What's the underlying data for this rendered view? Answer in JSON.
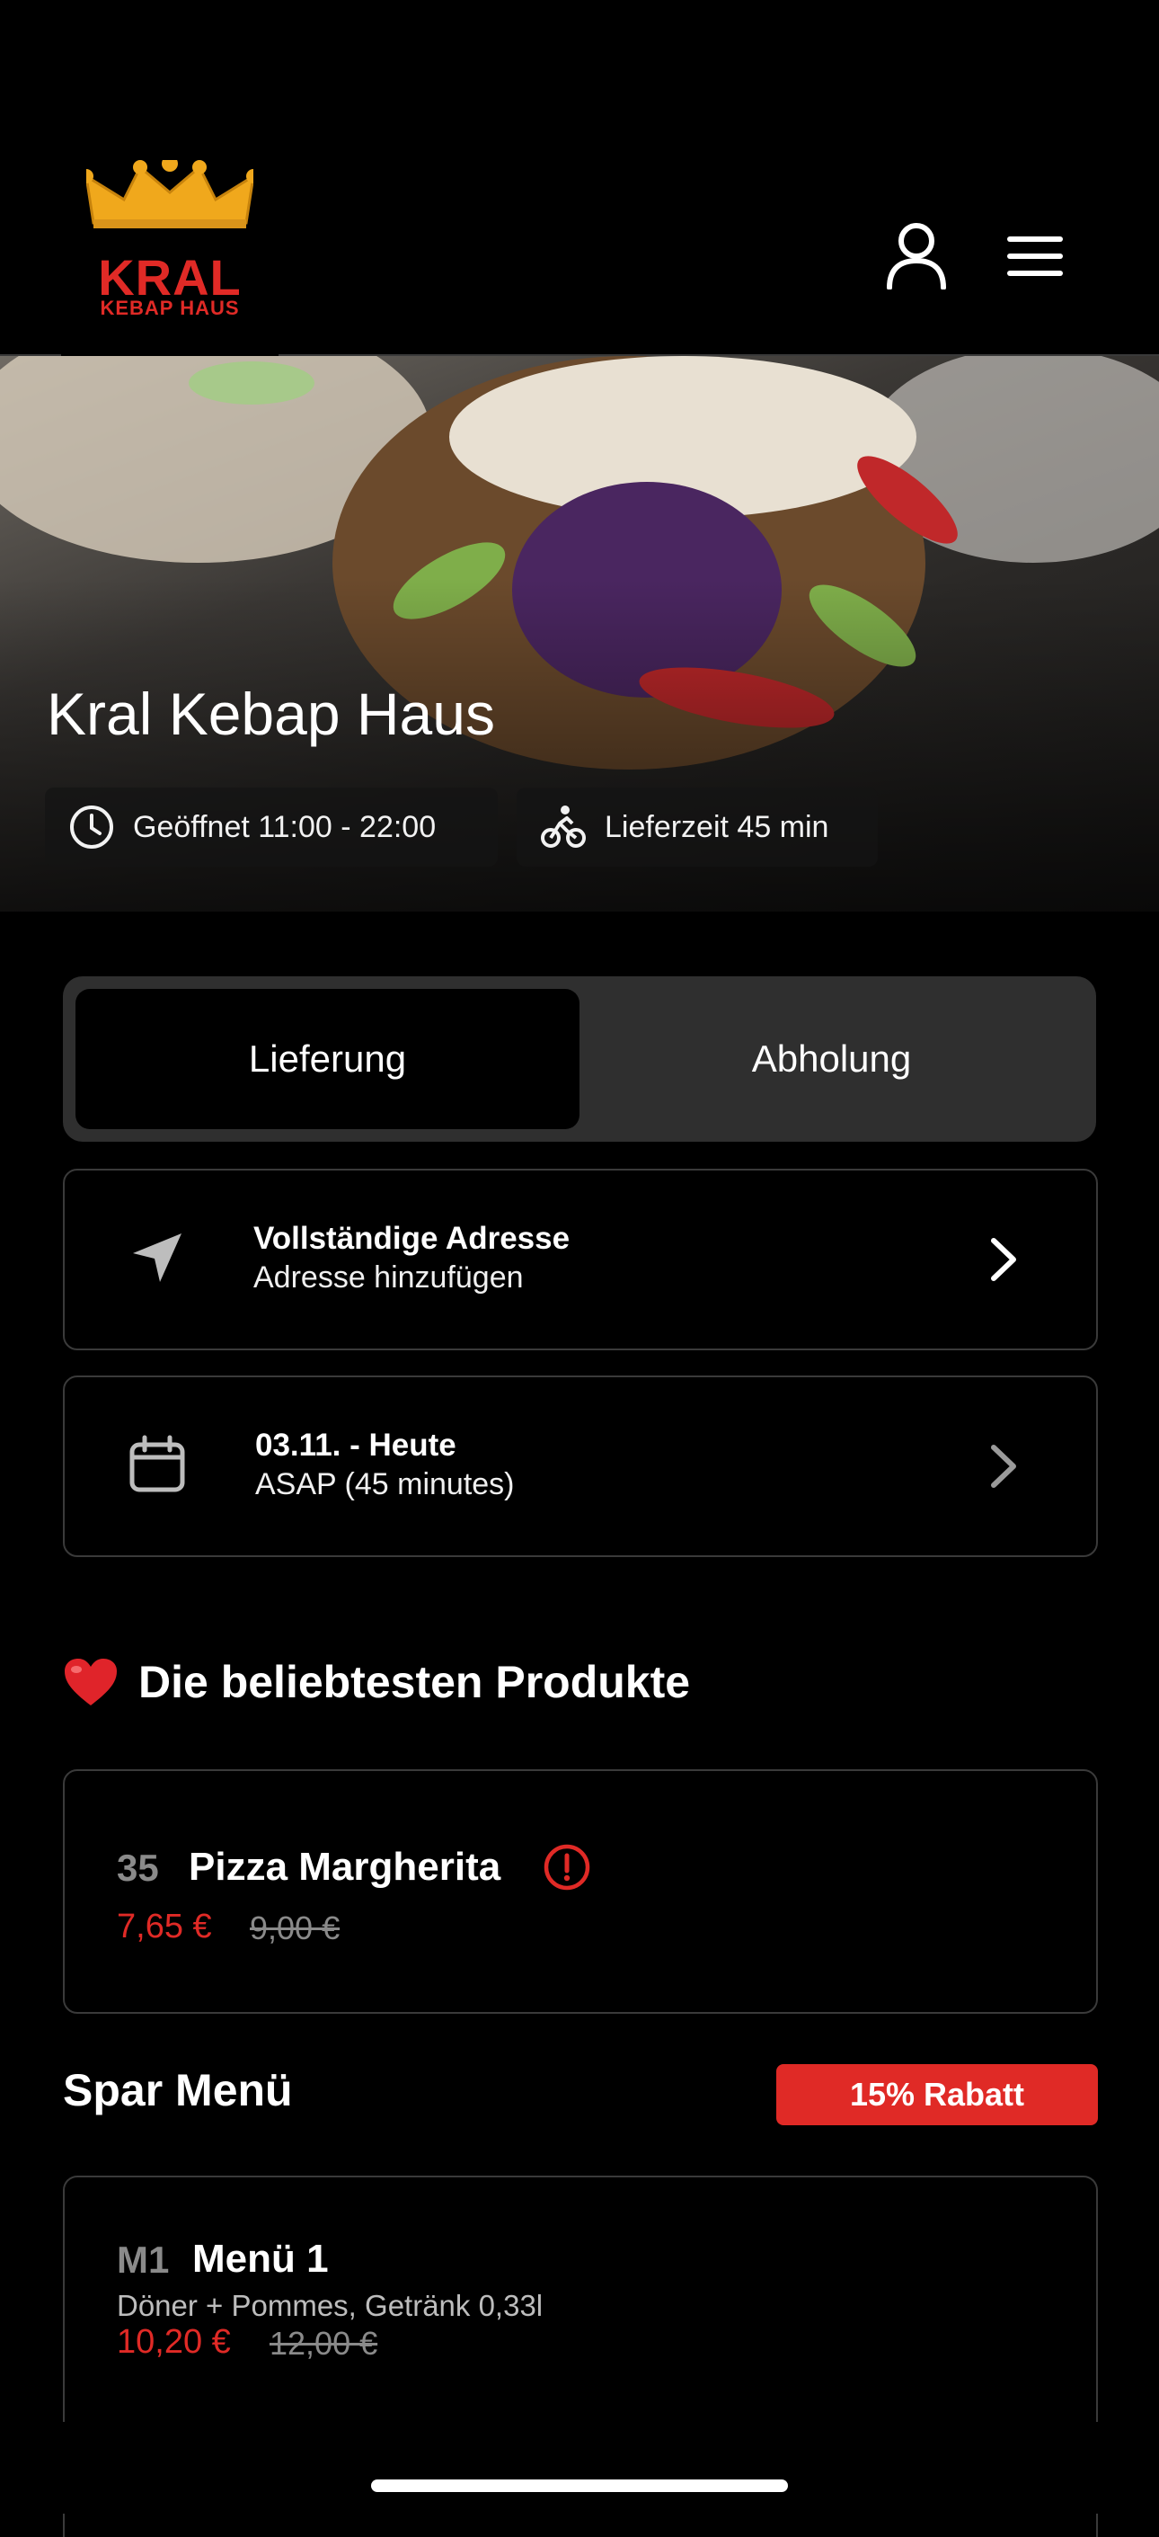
{
  "header": {
    "logo": {
      "name": "KRAL",
      "subtitle": "KEBAP HAUS",
      "crown_color": "#f0a81c",
      "brand_color": "#e02a26"
    },
    "icons": [
      "user-icon",
      "menu-icon"
    ]
  },
  "hero": {
    "title": "Kral Kebap Haus",
    "opening_hours": "Geöffnet 11:00 - 22:00",
    "delivery_time": "Lieferzeit 45 min"
  },
  "order_mode": {
    "options": [
      "Lieferung",
      "Abholung"
    ],
    "selected": "Lieferung"
  },
  "address": {
    "title": "Vollständige Adresse",
    "subtitle": "Adresse hinzufügen"
  },
  "schedule": {
    "title": "03.11. - Heute",
    "subtitle": "ASAP (45 minutes)"
  },
  "popular": {
    "title": "Die beliebtesten Produkte",
    "products": [
      {
        "number": "35",
        "name": "Pizza Margherita",
        "price": "7,65 €",
        "old_price": "9,00 €"
      }
    ]
  },
  "spar_menu": {
    "title": "Spar Menü",
    "badge": "15% Rabatt",
    "items": [
      {
        "code": "M1",
        "name": "Menü 1",
        "description": "Döner + Pommes, Getränk 0,33l",
        "price": "10,20 €",
        "old_price": "12,00 €"
      }
    ]
  },
  "colors": {
    "accent": "#e02a26",
    "background": "#000000",
    "card_border": "#3a3a3a",
    "toggle_bg": "#2f2f2f"
  }
}
